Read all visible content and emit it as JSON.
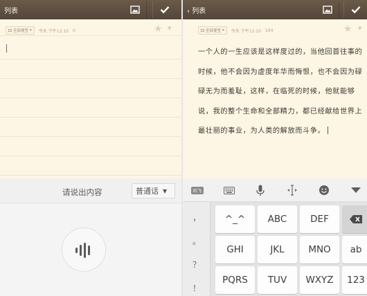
{
  "left": {
    "topbar": {
      "back_label": "列表",
      "image_icon": "image-icon",
      "done_icon": "checkmark-icon"
    },
    "note": {
      "category": "全部便签",
      "timestamp": "今天 下午12:10",
      "char_count": "0",
      "star_icon": "star-icon"
    },
    "voice": {
      "prompt": "请说出内容",
      "language": "普通话",
      "mic_icon": "voice-wave-icon"
    }
  },
  "right": {
    "topbar": {
      "back_label": "列表",
      "image_icon": "image-icon",
      "done_icon": "checkmark-icon"
    },
    "note": {
      "category": "全部便签",
      "timestamp": "今天 下午12:10",
      "char_count": "104",
      "star_icon": "star-icon",
      "lines": [
        "一个人的一生应该是这样度过的，当他回首往事的",
        "时候，他不会因为虚度年华而悔恨，也不会因为碌",
        "碌无为而羞耻，这样，在临死的时候，他就能够",
        "说，我的整个生命和全部精力，都已经献给世界上",
        "最壮丽的事业，为人类的解放而斗争。"
      ]
    },
    "ime_bar": {
      "logo": "讯飞",
      "icons": [
        "keyboard-icon",
        "microphone-icon",
        "cursor-move-icon",
        "emoji-icon",
        "collapse-triangle-icon"
      ]
    },
    "keyboard": {
      "punctuation": [
        "，",
        "。",
        "？",
        "！"
      ],
      "rows": [
        [
          "^_^",
          "ABC",
          "DEF"
        ],
        [
          "GHI",
          "JKL",
          "MNO"
        ],
        [
          "PQRS",
          "TUV",
          "WXYZ"
        ]
      ],
      "right_column": [
        "⌫",
        "ab",
        "123"
      ]
    }
  }
}
